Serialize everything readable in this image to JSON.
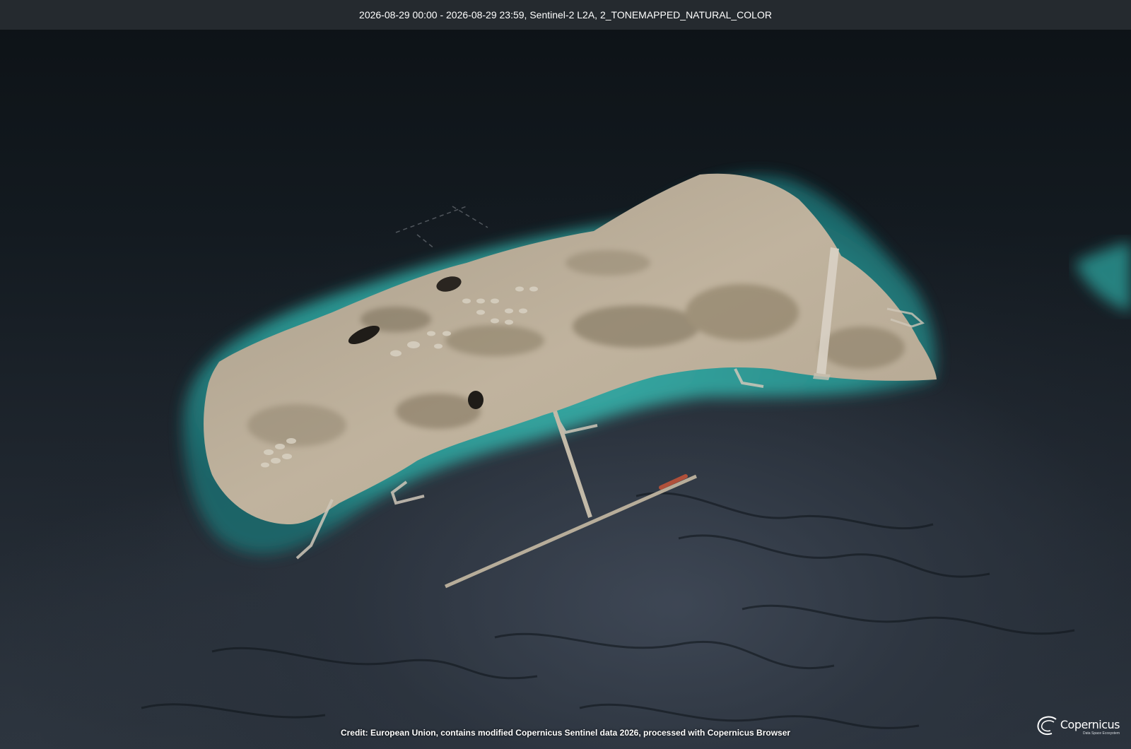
{
  "header": {
    "title": "2026-08-29 00:00 - 2026-08-29 23:59, Sentinel-2 L2A, 2_TONEMAPPED_NATURAL_COLOR"
  },
  "footer": {
    "credit": "Credit: European Union, contains modified Copernicus Sentinel data 2026, processed with Copernicus Browser"
  },
  "logo": {
    "name": "Copernicus",
    "subtitle": "Data Space Ecosystem"
  },
  "colors": {
    "title_bar": "#252a2f",
    "sea_deep": "#141b22",
    "sea_shallow": "#2fa9a2",
    "land": "#b9ab96"
  },
  "icons": {
    "logo": "copernicus-swoosh-icon"
  }
}
